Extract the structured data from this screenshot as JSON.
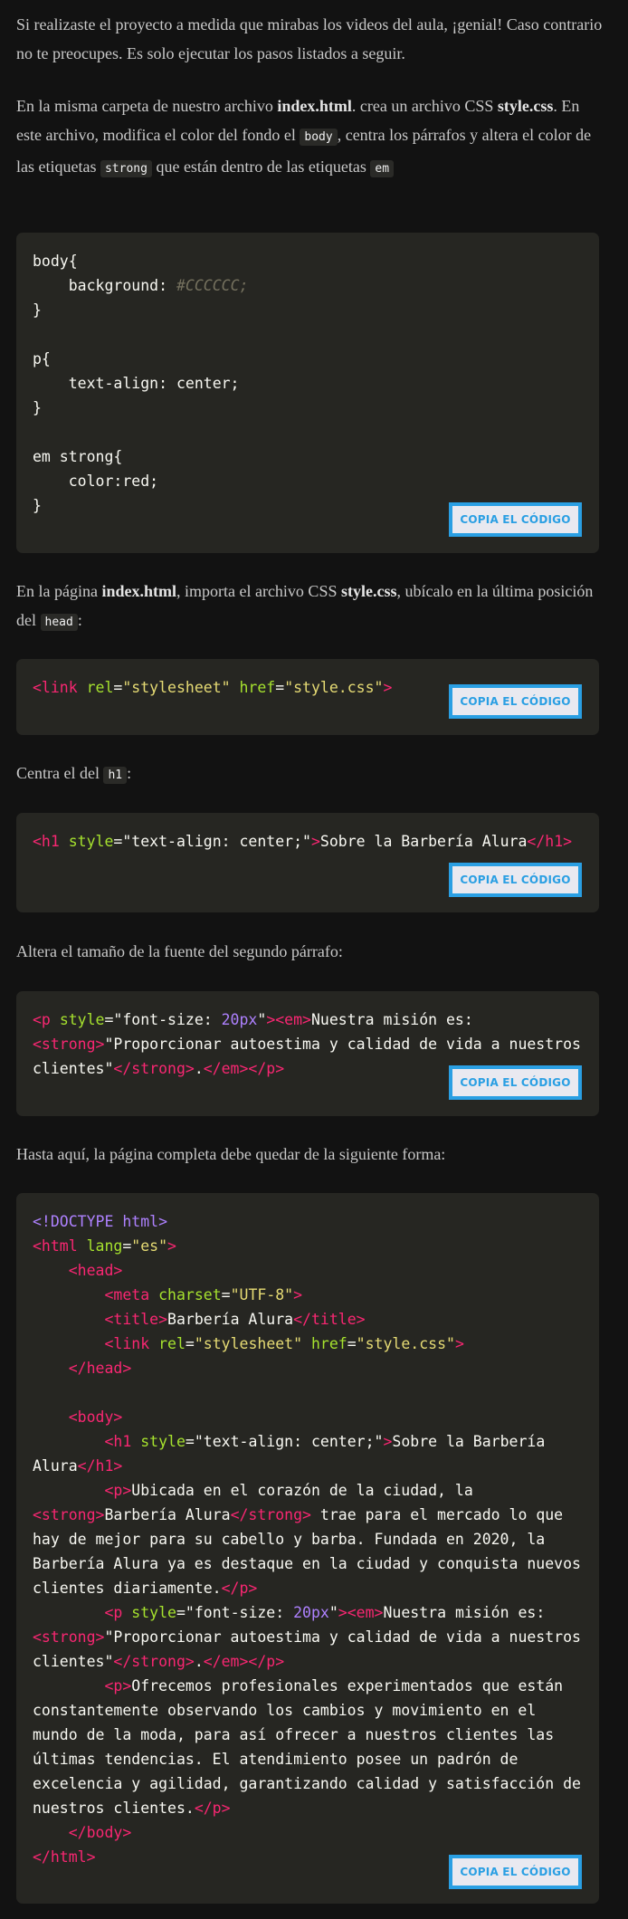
{
  "paragraphs": {
    "p1": "Si realizaste el proyecto a medida que mirabas los videos del aula, ¡genial! Caso contrario no te preocupes. Es solo ejecutar los pasos listados a seguir.",
    "p2": {
      "t1": "En la misma carpeta de nuestro archivo ",
      "b1": "index.html",
      "t2": ". crea un archivo CSS ",
      "b2": "style.css",
      "t3": ". En este archivo, modifica el color del fondo el ",
      "c1": "body",
      "t4": ", centra los párrafos y altera el color de las etiquetas ",
      "c2": "strong",
      "t5": " que están dentro de las etiquetas ",
      "c3": "em"
    },
    "p3": {
      "t1": "En la página ",
      "b1": "index.html",
      "t2": ", importa el archivo CSS ",
      "b2": "style.css",
      "t3": ", ubícalo en la última posición del ",
      "c1": "head",
      "t4": ":"
    },
    "p4": {
      "t1": "Centra el del ",
      "c1": "h1",
      "t2": ":"
    },
    "p5": "Altera el tamaño de la fuente del segundo párrafo:",
    "p6": "Hasta aquí, la página completa debe quedar de la siguiente forma:"
  },
  "copy_button_label": "COPIA EL CÓDIGO",
  "colors": {
    "tag": "#f92672",
    "attribute": "#a6e22e",
    "string": "#e6db74",
    "number": "#ae81ff",
    "comment": "#75715e",
    "button_accent": "#2a9fe3"
  },
  "code_blocks": [
    [
      [
        [
          "p",
          "body{"
        ]
      ],
      [
        [
          "p",
          "    background: "
        ],
        [
          "c",
          "#CCCCCC;"
        ]
      ],
      [
        [
          "p",
          "}"
        ]
      ],
      [
        [
          "p",
          ""
        ]
      ],
      [
        [
          "p",
          "p{"
        ]
      ],
      [
        [
          "p",
          "    text-align: center;"
        ]
      ],
      [
        [
          "p",
          "}"
        ]
      ],
      [
        [
          "p",
          ""
        ]
      ],
      [
        [
          "p",
          "em strong{"
        ]
      ],
      [
        [
          "p",
          "    color:red;"
        ]
      ],
      [
        [
          "p",
          "}"
        ]
      ]
    ],
    [
      [
        [
          "t",
          "<link "
        ],
        [
          "a",
          "rel"
        ],
        [
          "p",
          "="
        ],
        [
          "s",
          "\"stylesheet\" "
        ],
        [
          "a",
          "href"
        ],
        [
          "p",
          "="
        ],
        [
          "s",
          "\"style.css\""
        ],
        [
          "t",
          ">"
        ]
      ]
    ],
    [
      [
        [
          "t",
          "<h1 "
        ],
        [
          "a",
          "style"
        ],
        [
          "p",
          "=\"text-align: center;\""
        ],
        [
          "t",
          ">"
        ],
        [
          "p",
          "Sobre la Barbería Alura"
        ],
        [
          "t",
          "</h1>"
        ]
      ]
    ],
    [
      [
        [
          "t",
          "<p "
        ],
        [
          "a",
          "style"
        ],
        [
          "p",
          "=\"font-size: "
        ],
        [
          "n",
          "20px"
        ],
        [
          "p",
          "\""
        ],
        [
          "t",
          "><em>"
        ],
        [
          "p",
          "Nuestra misión es: "
        ],
        [
          "t",
          "<strong>"
        ],
        [
          "p",
          "\"Proporcionar autoestima y calidad de vida a nuestros clientes\""
        ],
        [
          "t",
          "</strong>"
        ],
        [
          "p",
          "."
        ],
        [
          "t",
          "</em></p>"
        ]
      ]
    ],
    [
      [
        [
          "n",
          "<!DOCTYPE html>"
        ]
      ],
      [
        [
          "t",
          "<html "
        ],
        [
          "a",
          "lang"
        ],
        [
          "p",
          "="
        ],
        [
          "s",
          "\"es\""
        ],
        [
          "t",
          ">"
        ]
      ],
      [
        [
          "p",
          "    "
        ],
        [
          "t",
          "<head>"
        ]
      ],
      [
        [
          "p",
          "        "
        ],
        [
          "t",
          "<meta "
        ],
        [
          "a",
          "charset"
        ],
        [
          "p",
          "="
        ],
        [
          "s",
          "\"UTF-8\""
        ],
        [
          "t",
          ">"
        ]
      ],
      [
        [
          "p",
          "        "
        ],
        [
          "t",
          "<title>"
        ],
        [
          "p",
          "Barbería Alura"
        ],
        [
          "t",
          "</title>"
        ]
      ],
      [
        [
          "p",
          "        "
        ],
        [
          "t",
          "<link "
        ],
        [
          "a",
          "rel"
        ],
        [
          "p",
          "="
        ],
        [
          "s",
          "\"stylesheet\" "
        ],
        [
          "a",
          "href"
        ],
        [
          "p",
          "="
        ],
        [
          "s",
          "\"style.css\""
        ],
        [
          "t",
          ">"
        ]
      ],
      [
        [
          "p",
          "    "
        ],
        [
          "t",
          "</head>"
        ]
      ],
      [
        [
          "p",
          ""
        ]
      ],
      [
        [
          "p",
          "    "
        ],
        [
          "t",
          "<body>"
        ]
      ],
      [
        [
          "p",
          "        "
        ],
        [
          "t",
          "<h1 "
        ],
        [
          "a",
          "style"
        ],
        [
          "p",
          "=\"text-align: center;\""
        ],
        [
          "t",
          ">"
        ],
        [
          "p",
          "Sobre la Barbería Alura"
        ],
        [
          "t",
          "</h1>"
        ]
      ],
      [
        [
          "p",
          "        "
        ],
        [
          "t",
          "<p>"
        ],
        [
          "p",
          "Ubicada en el corazón de la ciudad, la "
        ],
        [
          "t",
          "<strong>"
        ],
        [
          "p",
          "Barbería Alura"
        ],
        [
          "t",
          "</strong>"
        ],
        [
          "p",
          " trae para el mercado lo que hay de mejor para su cabello y barba. Fundada en 2020, la Barbería Alura ya es destaque en la ciudad y conquista nuevos clientes diariamente."
        ],
        [
          "t",
          "</p>"
        ]
      ],
      [
        [
          "p",
          "        "
        ],
        [
          "t",
          "<p "
        ],
        [
          "a",
          "style"
        ],
        [
          "p",
          "=\"font-size: "
        ],
        [
          "n",
          "20px"
        ],
        [
          "p",
          "\""
        ],
        [
          "t",
          "><em>"
        ],
        [
          "p",
          "Nuestra misión es: "
        ],
        [
          "t",
          "<strong>"
        ],
        [
          "p",
          "\"Proporcionar autoestima y calidad de vida a nuestros clientes\""
        ],
        [
          "t",
          "</strong>"
        ],
        [
          "p",
          "."
        ],
        [
          "t",
          "</em></p>"
        ]
      ],
      [
        [
          "p",
          "        "
        ],
        [
          "t",
          "<p>"
        ],
        [
          "p",
          "Ofrecemos profesionales experimentados que están constantemente observando los cambios y movimiento en el mundo de la moda, para así ofrecer a nuestros clientes las últimas tendencias. El atendimiento posee un padrón de excelencia y agilidad, garantizando calidad y satisfacción de nuestros clientes."
        ],
        [
          "t",
          "</p>"
        ]
      ],
      [
        [
          "p",
          "    "
        ],
        [
          "t",
          "</body>"
        ]
      ],
      [
        [
          "t",
          "</html>"
        ]
      ]
    ]
  ]
}
